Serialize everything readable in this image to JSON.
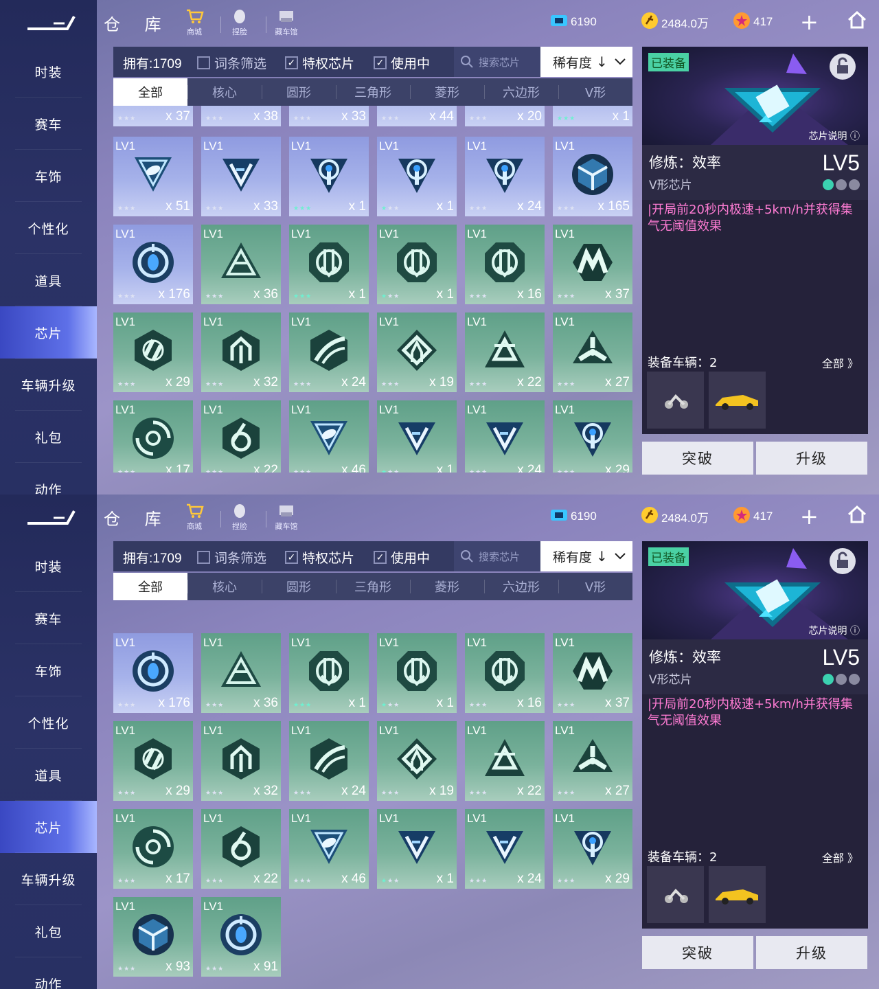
{
  "screens": [
    {
      "sidebar_items": [
        "时装",
        "赛车",
        "车饰",
        "个性化",
        "道具",
        "芯片",
        "车辆升级",
        "礼包",
        "动作"
      ],
      "active_sidebar": 5,
      "title": "仓 库",
      "nav": [
        {
          "label": "商城",
          "icon": "cart-icon"
        },
        {
          "label": "捏脸",
          "icon": "face-icon"
        },
        {
          "label": "藏车馆",
          "icon": "garage-icon"
        }
      ],
      "currencies": [
        {
          "value": "6190",
          "icon": "ticket-icon"
        },
        {
          "value": "2484.0万",
          "icon": "coin-icon"
        },
        {
          "value": "417",
          "icon": "diamond-icon"
        }
      ],
      "filter": {
        "own": "拥有:1709",
        "cb1": "词条筛选",
        "cb2": "特权芯片",
        "cb3": "使用中",
        "search_placeholder": "搜索芯片",
        "sort": "稀有度"
      },
      "tabs": [
        "全部",
        "核心",
        "圆形",
        "三角形",
        "菱形",
        "六边形",
        "V形"
      ],
      "partial_row": [
        {
          "count": "x 37",
          "stars": "★★★"
        },
        {
          "count": "x 38",
          "stars": "★★★"
        },
        {
          "count": "x 33",
          "stars": "★★★"
        },
        {
          "count": "x 44",
          "stars": "★★★"
        },
        {
          "count": "x 20",
          "stars": "★★★"
        },
        {
          "count": "x 1",
          "stars": "★★★",
          "lit": 3
        }
      ],
      "rows": [
        [
          {
            "lv": "LV1",
            "count": "x 51",
            "color": "purple",
            "shape": "tri"
          },
          {
            "lv": "LV1",
            "count": "x 33",
            "color": "purple",
            "shape": "v"
          },
          {
            "lv": "LV1",
            "count": "x 1",
            "color": "purple",
            "shape": "pin",
            "lit": 3
          },
          {
            "lv": "LV1",
            "count": "x 1",
            "color": "purple",
            "shape": "pin",
            "lit": 1
          },
          {
            "lv": "LV1",
            "count": "x 24",
            "color": "purple",
            "shape": "pin"
          },
          {
            "lv": "LV1",
            "count": "x 165",
            "color": "purple",
            "shape": "cube"
          }
        ],
        [
          {
            "lv": "LV1",
            "count": "x 176",
            "color": "purple",
            "shape": "core"
          },
          {
            "lv": "LV1",
            "count": "x 36",
            "color": "green",
            "shape": "tri2"
          },
          {
            "lv": "LV1",
            "count": "x 1",
            "color": "green",
            "shape": "oct",
            "lit": 3
          },
          {
            "lv": "LV1",
            "count": "x 1",
            "color": "green",
            "shape": "oct",
            "lit": 1
          },
          {
            "lv": "LV1",
            "count": "x 16",
            "color": "green",
            "shape": "oct"
          },
          {
            "lv": "LV1",
            "count": "x 37",
            "color": "green",
            "shape": "m"
          }
        ],
        [
          {
            "lv": "LV1",
            "count": "x 29",
            "color": "green",
            "shape": "hex"
          },
          {
            "lv": "LV1",
            "count": "x 32",
            "color": "green",
            "shape": "hex2"
          },
          {
            "lv": "LV1",
            "count": "x 24",
            "color": "green",
            "shape": "hex3"
          },
          {
            "lv": "LV1",
            "count": "x 19",
            "color": "green",
            "shape": "dia"
          },
          {
            "lv": "LV1",
            "count": "x 22",
            "color": "green",
            "shape": "tri3"
          },
          {
            "lv": "LV1",
            "count": "x 27",
            "color": "green",
            "shape": "tri4"
          }
        ],
        [
          {
            "lv": "LV1",
            "count": "x 17",
            "color": "green",
            "shape": "swirl"
          },
          {
            "lv": "LV1",
            "count": "x 22",
            "color": "green",
            "shape": "six"
          },
          {
            "lv": "LV1",
            "count": "x 46",
            "color": "green",
            "shape": "tri"
          },
          {
            "lv": "LV1",
            "count": "x 1",
            "color": "green",
            "shape": "v",
            "lit": 1
          },
          {
            "lv": "LV1",
            "count": "x 24",
            "color": "green",
            "shape": "v"
          },
          {
            "lv": "LV1",
            "count": "x 29",
            "color": "green",
            "shape": "pin"
          }
        ]
      ],
      "panel": {
        "equipped": "已装备",
        "chip_note": "芯片说明",
        "name": "修炼：效率",
        "type": "V形芯片",
        "level": "LV5",
        "desc": "|开局前20秒内极速+5km/h并获得集气无阈值效果",
        "vehicles_label": "装备车辆：2",
        "vehicles_all": "全部 》"
      },
      "buttons": {
        "break": "突破",
        "upgrade": "升级"
      }
    },
    {
      "sidebar_items": [
        "时装",
        "赛车",
        "车饰",
        "个性化",
        "道具",
        "芯片",
        "车辆升级",
        "礼包",
        "动作"
      ],
      "active_sidebar": 5,
      "title": "仓 库",
      "nav": [
        {
          "label": "商城",
          "icon": "cart-icon"
        },
        {
          "label": "捏脸",
          "icon": "face-icon"
        },
        {
          "label": "藏车馆",
          "icon": "garage-icon"
        }
      ],
      "currencies": [
        {
          "value": "6190",
          "icon": "ticket-icon"
        },
        {
          "value": "2484.0万",
          "icon": "coin-icon"
        },
        {
          "value": "417",
          "icon": "diamond-icon"
        }
      ],
      "filter": {
        "own": "拥有:1709",
        "cb1": "词条筛选",
        "cb2": "特权芯片",
        "cb3": "使用中",
        "search_placeholder": "搜索芯片",
        "sort": "稀有度"
      },
      "tabs": [
        "全部",
        "核心",
        "圆形",
        "三角形",
        "菱形",
        "六边形",
        "V形"
      ],
      "partial_row": [],
      "rows": [
        [
          {
            "lv": "LV1",
            "count": "x 176",
            "color": "purple",
            "shape": "core"
          },
          {
            "lv": "LV1",
            "count": "x 36",
            "color": "green",
            "shape": "tri2"
          },
          {
            "lv": "LV1",
            "count": "x 1",
            "color": "green",
            "shape": "oct",
            "lit": 3
          },
          {
            "lv": "LV1",
            "count": "x 1",
            "color": "green",
            "shape": "oct",
            "lit": 1
          },
          {
            "lv": "LV1",
            "count": "x 16",
            "color": "green",
            "shape": "oct"
          },
          {
            "lv": "LV1",
            "count": "x 37",
            "color": "green",
            "shape": "m"
          }
        ],
        [
          {
            "lv": "LV1",
            "count": "x 29",
            "color": "green",
            "shape": "hex"
          },
          {
            "lv": "LV1",
            "count": "x 32",
            "color": "green",
            "shape": "hex2"
          },
          {
            "lv": "LV1",
            "count": "x 24",
            "color": "green",
            "shape": "hex3"
          },
          {
            "lv": "LV1",
            "count": "x 19",
            "color": "green",
            "shape": "dia"
          },
          {
            "lv": "LV1",
            "count": "x 22",
            "color": "green",
            "shape": "tri3"
          },
          {
            "lv": "LV1",
            "count": "x 27",
            "color": "green",
            "shape": "tri4"
          }
        ],
        [
          {
            "lv": "LV1",
            "count": "x 17",
            "color": "green",
            "shape": "swirl"
          },
          {
            "lv": "LV1",
            "count": "x 22",
            "color": "green",
            "shape": "six"
          },
          {
            "lv": "LV1",
            "count": "x 46",
            "color": "green",
            "shape": "tri"
          },
          {
            "lv": "LV1",
            "count": "x 1",
            "color": "green",
            "shape": "v",
            "lit": 1
          },
          {
            "lv": "LV1",
            "count": "x 24",
            "color": "green",
            "shape": "v"
          },
          {
            "lv": "LV1",
            "count": "x 29",
            "color": "green",
            "shape": "pin"
          }
        ],
        [
          {
            "lv": "LV1",
            "count": "x 93",
            "color": "green",
            "shape": "cube"
          },
          {
            "lv": "LV1",
            "count": "x 91",
            "color": "green",
            "shape": "core"
          }
        ]
      ],
      "panel": {
        "equipped": "已装备",
        "chip_note": "芯片说明",
        "name": "修炼：效率",
        "type": "V形芯片",
        "level": "LV5",
        "desc": "|开局前20秒内极速+5km/h并获得集气无阈值效果",
        "vehicles_label": "装备车辆：2",
        "vehicles_all": "全部 》"
      },
      "buttons": {
        "break": "突破",
        "upgrade": "升级"
      }
    }
  ]
}
